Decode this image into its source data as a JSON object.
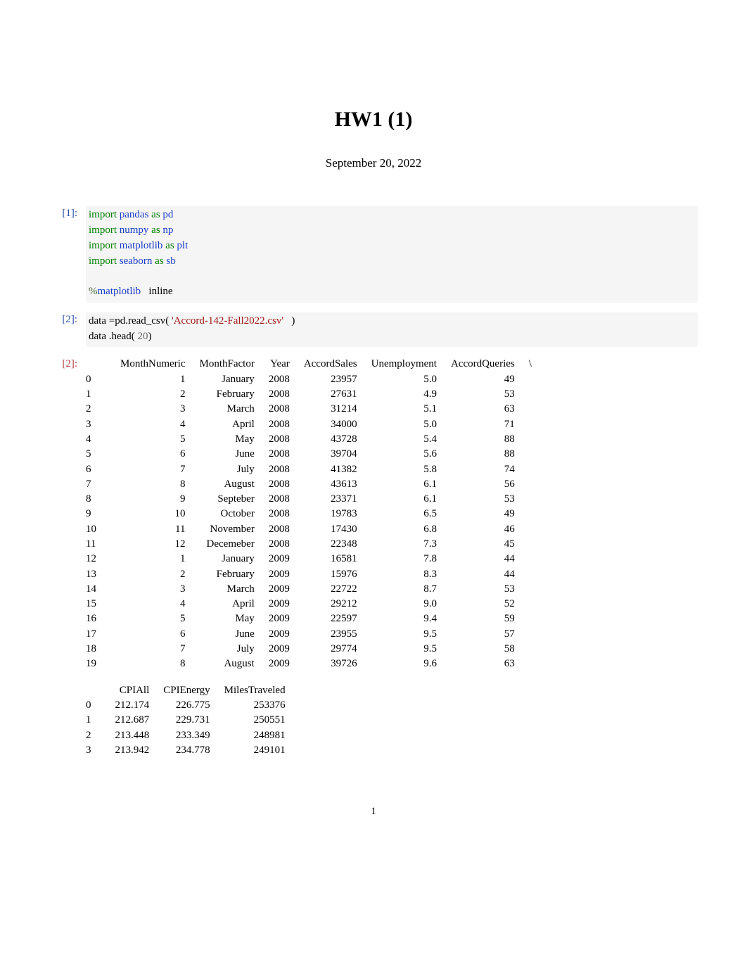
{
  "title": "HW1 (1)",
  "date": "September 20, 2022",
  "pagenum": "1",
  "cells": {
    "c1": {
      "prompt": "[1]:",
      "code": [
        {
          "tokens": [
            {
              "t": "import",
              "c": "kw"
            },
            {
              "t": " "
            },
            {
              "t": "pandas",
              "c": "mod"
            },
            {
              "t": " "
            },
            {
              "t": "as",
              "c": "kw"
            },
            {
              "t": " "
            },
            {
              "t": "pd",
              "c": "mod"
            }
          ]
        },
        {
          "tokens": [
            {
              "t": "import",
              "c": "kw"
            },
            {
              "t": " "
            },
            {
              "t": "numpy",
              "c": "mod"
            },
            {
              "t": " "
            },
            {
              "t": "as",
              "c": "kw"
            },
            {
              "t": " "
            },
            {
              "t": "np",
              "c": "mod"
            }
          ]
        },
        {
          "tokens": [
            {
              "t": "import",
              "c": "kw"
            },
            {
              "t": " "
            },
            {
              "t": "matplotlib",
              "c": "mod"
            },
            {
              "t": " "
            },
            {
              "t": "as",
              "c": "kw"
            },
            {
              "t": " "
            },
            {
              "t": "plt",
              "c": "mod"
            }
          ]
        },
        {
          "tokens": [
            {
              "t": "import",
              "c": "kw"
            },
            {
              "t": " "
            },
            {
              "t": "seaborn",
              "c": "mod"
            },
            {
              "t": " "
            },
            {
              "t": "as",
              "c": "kw"
            },
            {
              "t": " "
            },
            {
              "t": "sb",
              "c": "mod"
            }
          ]
        },
        {
          "tokens": [
            {
              "t": " "
            }
          ]
        },
        {
          "tokens": [
            {
              "t": "%",
              "c": "mag"
            },
            {
              "t": "matplotlib",
              "c": "mod"
            },
            {
              "t": "   inline"
            }
          ]
        }
      ]
    },
    "c2": {
      "prompt": "[2]:",
      "code": [
        {
          "tokens": [
            {
              "t": "data "
            },
            {
              "t": "="
            },
            {
              "t": "pd"
            },
            {
              "t": "."
            },
            {
              "t": "read_csv( "
            },
            {
              "t": "'Accord-142-Fall2022.csv'",
              "c": "str"
            },
            {
              "t": "   )"
            }
          ]
        },
        {
          "tokens": [
            {
              "t": "data "
            },
            {
              "t": "."
            },
            {
              "t": "head( "
            },
            {
              "t": "20",
              "c": "num"
            },
            {
              "t": ")"
            }
          ]
        }
      ]
    },
    "out2": {
      "prompt": "[2]:"
    }
  },
  "table1": {
    "headers": [
      "",
      "MonthNumeric",
      "MonthFactor",
      "Year",
      "AccordSales",
      "Unemployment",
      "AccordQueries"
    ],
    "contMark": "\\",
    "rows": [
      [
        "0",
        "1",
        "January",
        "2008",
        "23957",
        "5.0",
        "49"
      ],
      [
        "1",
        "2",
        "February",
        "2008",
        "27631",
        "4.9",
        "53"
      ],
      [
        "2",
        "3",
        "March",
        "2008",
        "31214",
        "5.1",
        "63"
      ],
      [
        "3",
        "4",
        "April",
        "2008",
        "34000",
        "5.0",
        "71"
      ],
      [
        "4",
        "5",
        "May",
        "2008",
        "43728",
        "5.4",
        "88"
      ],
      [
        "5",
        "6",
        "June",
        "2008",
        "39704",
        "5.6",
        "88"
      ],
      [
        "6",
        "7",
        "July",
        "2008",
        "41382",
        "5.8",
        "74"
      ],
      [
        "7",
        "8",
        "August",
        "2008",
        "43613",
        "6.1",
        "56"
      ],
      [
        "8",
        "9",
        "Septeber",
        "2008",
        "23371",
        "6.1",
        "53"
      ],
      [
        "9",
        "10",
        "October",
        "2008",
        "19783",
        "6.5",
        "49"
      ],
      [
        "10",
        "11",
        "November",
        "2008",
        "17430",
        "6.8",
        "46"
      ],
      [
        "11",
        "12",
        "Decemeber",
        "2008",
        "22348",
        "7.3",
        "45"
      ],
      [
        "12",
        "1",
        "January",
        "2009",
        "16581",
        "7.8",
        "44"
      ],
      [
        "13",
        "2",
        "February",
        "2009",
        "15976",
        "8.3",
        "44"
      ],
      [
        "14",
        "3",
        "March",
        "2009",
        "22722",
        "8.7",
        "53"
      ],
      [
        "15",
        "4",
        "April",
        "2009",
        "29212",
        "9.0",
        "52"
      ],
      [
        "16",
        "5",
        "May",
        "2009",
        "22597",
        "9.4",
        "59"
      ],
      [
        "17",
        "6",
        "June",
        "2009",
        "23955",
        "9.5",
        "57"
      ],
      [
        "18",
        "7",
        "July",
        "2009",
        "29774",
        "9.5",
        "58"
      ],
      [
        "19",
        "8",
        "August",
        "2009",
        "39726",
        "9.6",
        "63"
      ]
    ]
  },
  "table2": {
    "headers": [
      "",
      "CPIAll",
      "CPIEnergy",
      "MilesTraveled"
    ],
    "rows": [
      [
        "0",
        "212.174",
        "226.775",
        "253376"
      ],
      [
        "1",
        "212.687",
        "229.731",
        "250551"
      ],
      [
        "2",
        "213.448",
        "233.349",
        "248981"
      ],
      [
        "3",
        "213.942",
        "234.778",
        "249101"
      ]
    ]
  }
}
